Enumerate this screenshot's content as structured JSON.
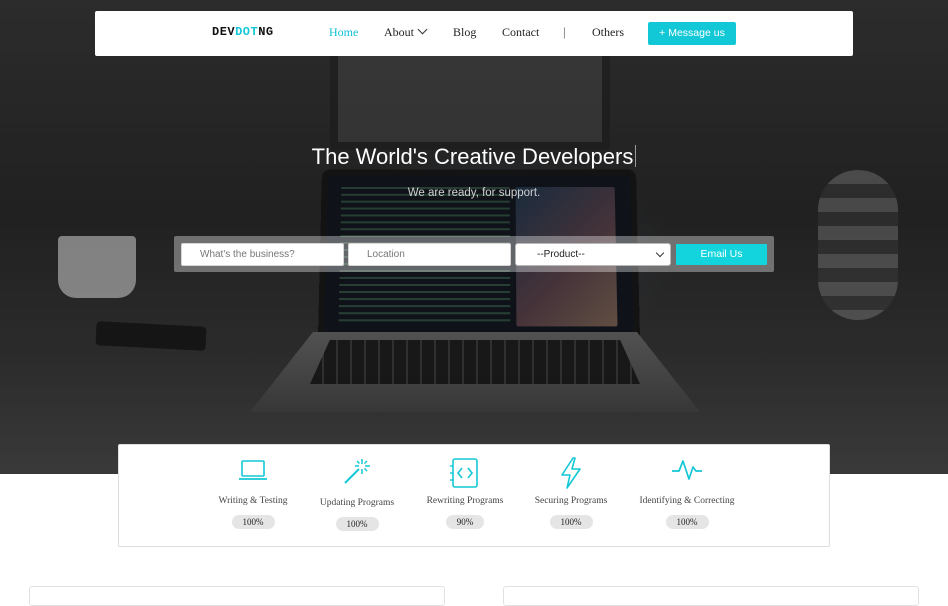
{
  "brand": {
    "part1": "DEV",
    "part2": "DOT",
    "part3": "NG",
    "accent_color": "#12c8d8"
  },
  "nav": {
    "home": "Home",
    "about": "About",
    "blog": "Blog",
    "contact": "Contact",
    "separator": "|",
    "others": "Others",
    "message_button": "+ Message us"
  },
  "hero": {
    "title": "The World's Creative Developers",
    "subtitle": "We are ready, for support."
  },
  "search": {
    "business_placeholder": "What's the business?",
    "location_placeholder": "Location",
    "product_selected": "--Product--",
    "submit": "Email Us"
  },
  "features": [
    {
      "label": "Writing & Testing",
      "percent": "100%",
      "icon": "laptop-icon"
    },
    {
      "label": "Updating Programs",
      "percent": "100%",
      "icon": "magic-wand-icon"
    },
    {
      "label": "Rewriting Programs",
      "percent": "90%",
      "icon": "code-file-icon"
    },
    {
      "label": "Securing Programs",
      "percent": "100%",
      "icon": "lightning-icon"
    },
    {
      "label": "Identifying & Correcting",
      "percent": "100%",
      "icon": "pulse-icon"
    }
  ],
  "colors": {
    "accent": "#13c8d6",
    "accent_button": "#13d4dc"
  }
}
